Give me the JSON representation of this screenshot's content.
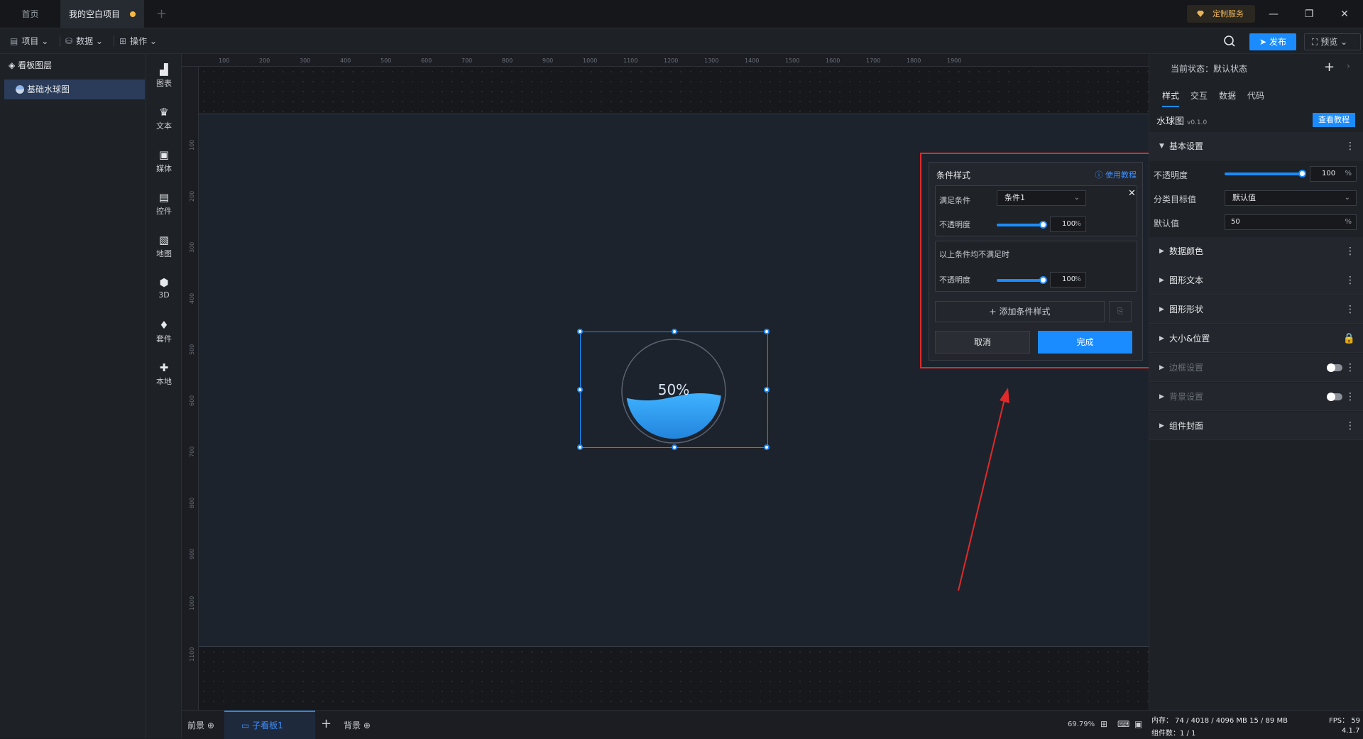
{
  "titlebar": {
    "tabs": [
      {
        "label": "首页"
      },
      {
        "label": "我的空白项目"
      }
    ],
    "custom_service": "定制服务"
  },
  "toolbar": {
    "menus": [
      {
        "label": "项目"
      },
      {
        "label": "数据"
      },
      {
        "label": "操作"
      }
    ],
    "publish": "发布",
    "preview": "预览"
  },
  "layers": {
    "title": "看板图层",
    "items": [
      {
        "label": "基础水球图"
      }
    ]
  },
  "widgets": [
    {
      "label": "图表",
      "icon": "bar-chart-icon"
    },
    {
      "label": "文本",
      "icon": "crown-icon"
    },
    {
      "label": "媒体",
      "icon": "media-icon"
    },
    {
      "label": "控件",
      "icon": "control-icon"
    },
    {
      "label": "地图",
      "icon": "map-icon"
    },
    {
      "label": "3D",
      "icon": "cube-icon"
    },
    {
      "label": "套件",
      "icon": "kit-icon"
    },
    {
      "label": "本地",
      "icon": "puzzle-icon"
    }
  ],
  "rulers": {
    "top": [
      "100",
      "200",
      "300",
      "400",
      "500",
      "600",
      "700",
      "800",
      "900",
      "1000",
      "1100",
      "1200",
      "1300",
      "1400",
      "1500",
      "1600",
      "1700",
      "1800",
      "1900"
    ],
    "left": [
      "100",
      "200",
      "300",
      "400",
      "500",
      "600",
      "700",
      "800",
      "900",
      "1000",
      "1100"
    ]
  },
  "canvas": {
    "liquid_value": 0.5,
    "liquid_label": "50%"
  },
  "condition_panel": {
    "title": "条件样式",
    "tutorial": "使用教程",
    "condition_label": "满足条件",
    "condition_value": "条件1",
    "opacity_label": "不透明度",
    "opacity_value": "100",
    "unit": "%",
    "fallback_title": "以上条件均不满足时",
    "fallback_opacity_label": "不透明度",
    "fallback_opacity_value": "100",
    "add_button": "添加条件样式",
    "cancel": "取消",
    "done": "完成"
  },
  "right_panel": {
    "state": "当前状态：默认状态",
    "tabs": [
      {
        "label": "样式"
      },
      {
        "label": "交互"
      },
      {
        "label": "数据"
      },
      {
        "label": "代码"
      }
    ],
    "widget_name": "水球图",
    "widget_version": "v0.1.0",
    "tutorial_button": "查看教程",
    "basic_settings": "基本设置",
    "opacity_label": "不透明度",
    "opacity_value": "100",
    "opacity_unit": "%",
    "category_label": "分类目标值",
    "category_value": "默认值",
    "default_label": "默认值",
    "default_value": "50",
    "default_unit": "%",
    "sections": [
      {
        "label": "数据颜色"
      },
      {
        "label": "图形文本"
      },
      {
        "label": "图形形状"
      },
      {
        "label": "大小&位置"
      },
      {
        "label": "边框设置"
      },
      {
        "label": "背景设置"
      },
      {
        "label": "组件封面"
      }
    ]
  },
  "statusbar": {
    "foreground": "前景",
    "sub_board": "子看板1",
    "background": "背景",
    "zoom": "69.79%",
    "memory": "内存： 74 / 4018 / 4096 MB  15 / 89 MB",
    "fps": "FPS： 59",
    "components": "组件数：1 / 1",
    "version": "4.1.7"
  },
  "colors": {
    "accent": "#1a8cff",
    "highlight": "#e02a2a",
    "liquid": "#2a9bf0"
  }
}
